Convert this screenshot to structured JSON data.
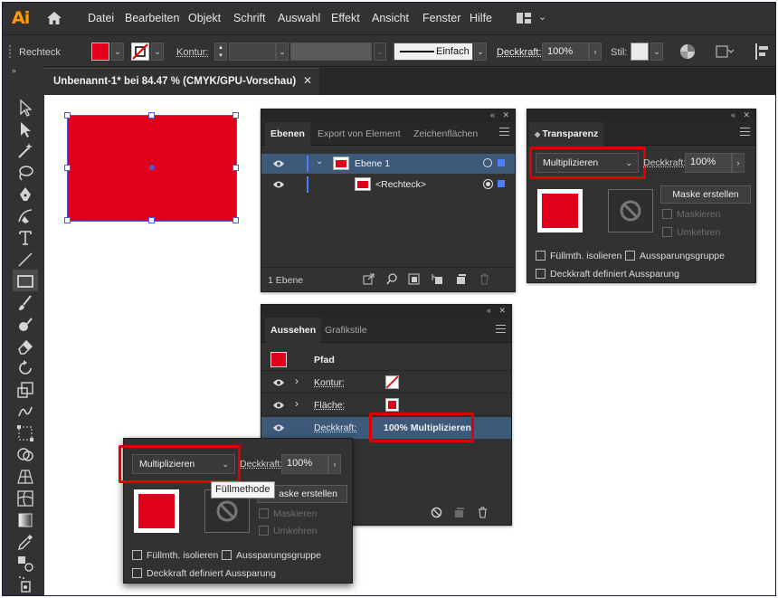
{
  "app": {
    "logo": "Ai"
  },
  "menu": [
    "Datei",
    "Bearbeiten",
    "Objekt",
    "Schrift",
    "Auswahl",
    "Effekt",
    "Ansicht",
    "Fenster",
    "Hilfe"
  ],
  "control_bar": {
    "object_type": "Rechteck",
    "fill_color": "#e0001b",
    "stroke_label": "Kontur:",
    "stroke_style": "Einfach",
    "opacity_label": "Deckkraft:",
    "opacity_value": "100%",
    "style_label": "Stil:"
  },
  "document_tab": {
    "title": "Unbenannt-1* bei 84.47 % (CMYK/GPU-Vorschau)",
    "close": "✕"
  },
  "canvas": {
    "rect_color": "#e0001b",
    "selection_color": "#4f5bd5"
  },
  "layers_panel": {
    "tabs": [
      "Ebenen",
      "Export von Element",
      "Zeichenflächen"
    ],
    "layer_name": "Ebene 1",
    "sublayer_name": "<Rechteck>",
    "footer_count": "1 Ebene"
  },
  "transparency_panel": {
    "title": "Transparenz",
    "blend_mode": "Multiplizieren",
    "opacity_label": "Deckkraft:",
    "opacity_value": "100%",
    "mask_button": "Maske erstellen",
    "clip": "Maskieren",
    "invert": "Umkehren",
    "isolate": "Füllmth. isolieren",
    "knockout": "Aussparungsgruppe",
    "opacity_defines": "Deckkraft definiert Aussparung"
  },
  "appearance_panel": {
    "tabs": [
      "Aussehen",
      "Grafikstile"
    ],
    "path_label": "Pfad",
    "stroke_label": "Kontur:",
    "fill_label": "Fläche:",
    "opacity_label": "Deckkraft:",
    "opacity_value": "100% Multiplizieren"
  },
  "popup_panel": {
    "blend_mode": "Multiplizieren",
    "opacity_label": "Deckkraft:",
    "opacity_value": "100%",
    "tooltip": "Füllmethode",
    "mask_button_partial": "aske erstellen",
    "clip": "Maskieren",
    "invert": "Umkehren",
    "isolate": "Füllmth. isolieren",
    "knockout": "Aussparungsgruppe",
    "opacity_defines": "Deckkraft definiert Aussparung"
  },
  "colors": {
    "highlight": "#e00000",
    "panel_bg": "#323232",
    "layer_selected": "#3d5a7a"
  }
}
